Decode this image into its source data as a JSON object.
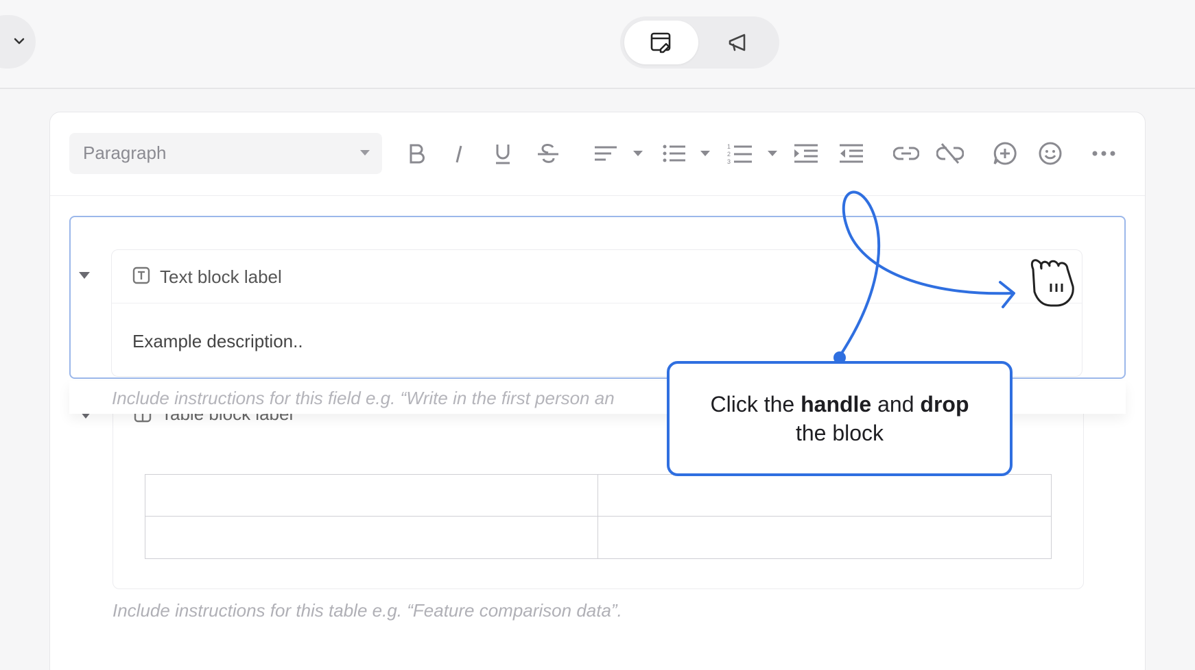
{
  "topbar": {
    "left_dropdown_icon": "chevron-down-icon",
    "mode_toggle": [
      {
        "icon": "edit-document-icon",
        "active": true
      },
      {
        "icon": "megaphone-icon",
        "active": false
      }
    ]
  },
  "toolbar": {
    "paragraph_select": "Paragraph",
    "buttons": [
      "bold-icon",
      "italic-icon",
      "underline-icon",
      "strikethrough-icon",
      "align-icon",
      "bullet-list-icon",
      "numbered-list-icon",
      "indent-icon",
      "outdent-icon",
      "link-icon",
      "unlink-icon",
      "add-comment-icon",
      "emoji-icon",
      "more-icon"
    ]
  },
  "text_block": {
    "label": "Text block label",
    "description": "Example description..",
    "instructions": "Include instructions for this field e.g. “Write in the first person an"
  },
  "table_block": {
    "label": "Table block label",
    "instructions": "Include instructions for this table e.g. “Feature comparison data”."
  },
  "callout": {
    "part1": "Click the ",
    "bold1": "handle",
    "part2": " and ",
    "bold2": "drop",
    "part3": " the block"
  },
  "colors": {
    "accent": "#2f6fe0",
    "frame": "#9bb7ea"
  }
}
